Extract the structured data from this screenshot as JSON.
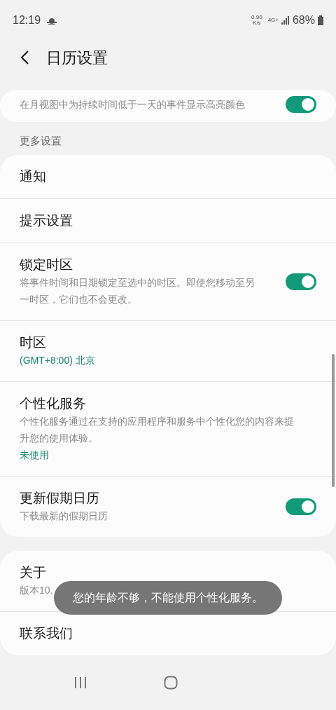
{
  "status_bar": {
    "time": "12:19",
    "net_speed": "0.90",
    "net_unit": "K/s",
    "network": "4G+",
    "battery": "68%"
  },
  "header": {
    "title": "日历设置"
  },
  "top_card": {
    "subtitle": "在月视图中为持续时间低于一天的事件显示高亮颜色",
    "on": true
  },
  "section": {
    "label": "更多设置"
  },
  "settings": [
    {
      "kind": "plain",
      "title": "通知"
    },
    {
      "kind": "plain",
      "title": "提示设置"
    },
    {
      "kind": "toggle",
      "title": "锁定时区",
      "subtitle": "将事件时间和日期锁定至选中的时区。即使您移动至另一时区，它们也不会更改。",
      "on": true
    },
    {
      "kind": "value",
      "title": "时区",
      "value": "(GMT+8:00) 北京"
    },
    {
      "kind": "value",
      "title": "个性化服务",
      "subtitle": "个性化服务通过在支持的应用程序和服务中个性化您的内容来提升您的使用体验。",
      "value": "未使用"
    },
    {
      "kind": "toggle",
      "title": "更新假期日历",
      "subtitle": "下载最新的假期日历",
      "on": true
    }
  ],
  "about": [
    {
      "title": "关于",
      "subtitle": "版本10."
    },
    {
      "title": "联系我们"
    }
  ],
  "toast": {
    "text": "您的年龄不够，不能使用个性化服务。"
  }
}
